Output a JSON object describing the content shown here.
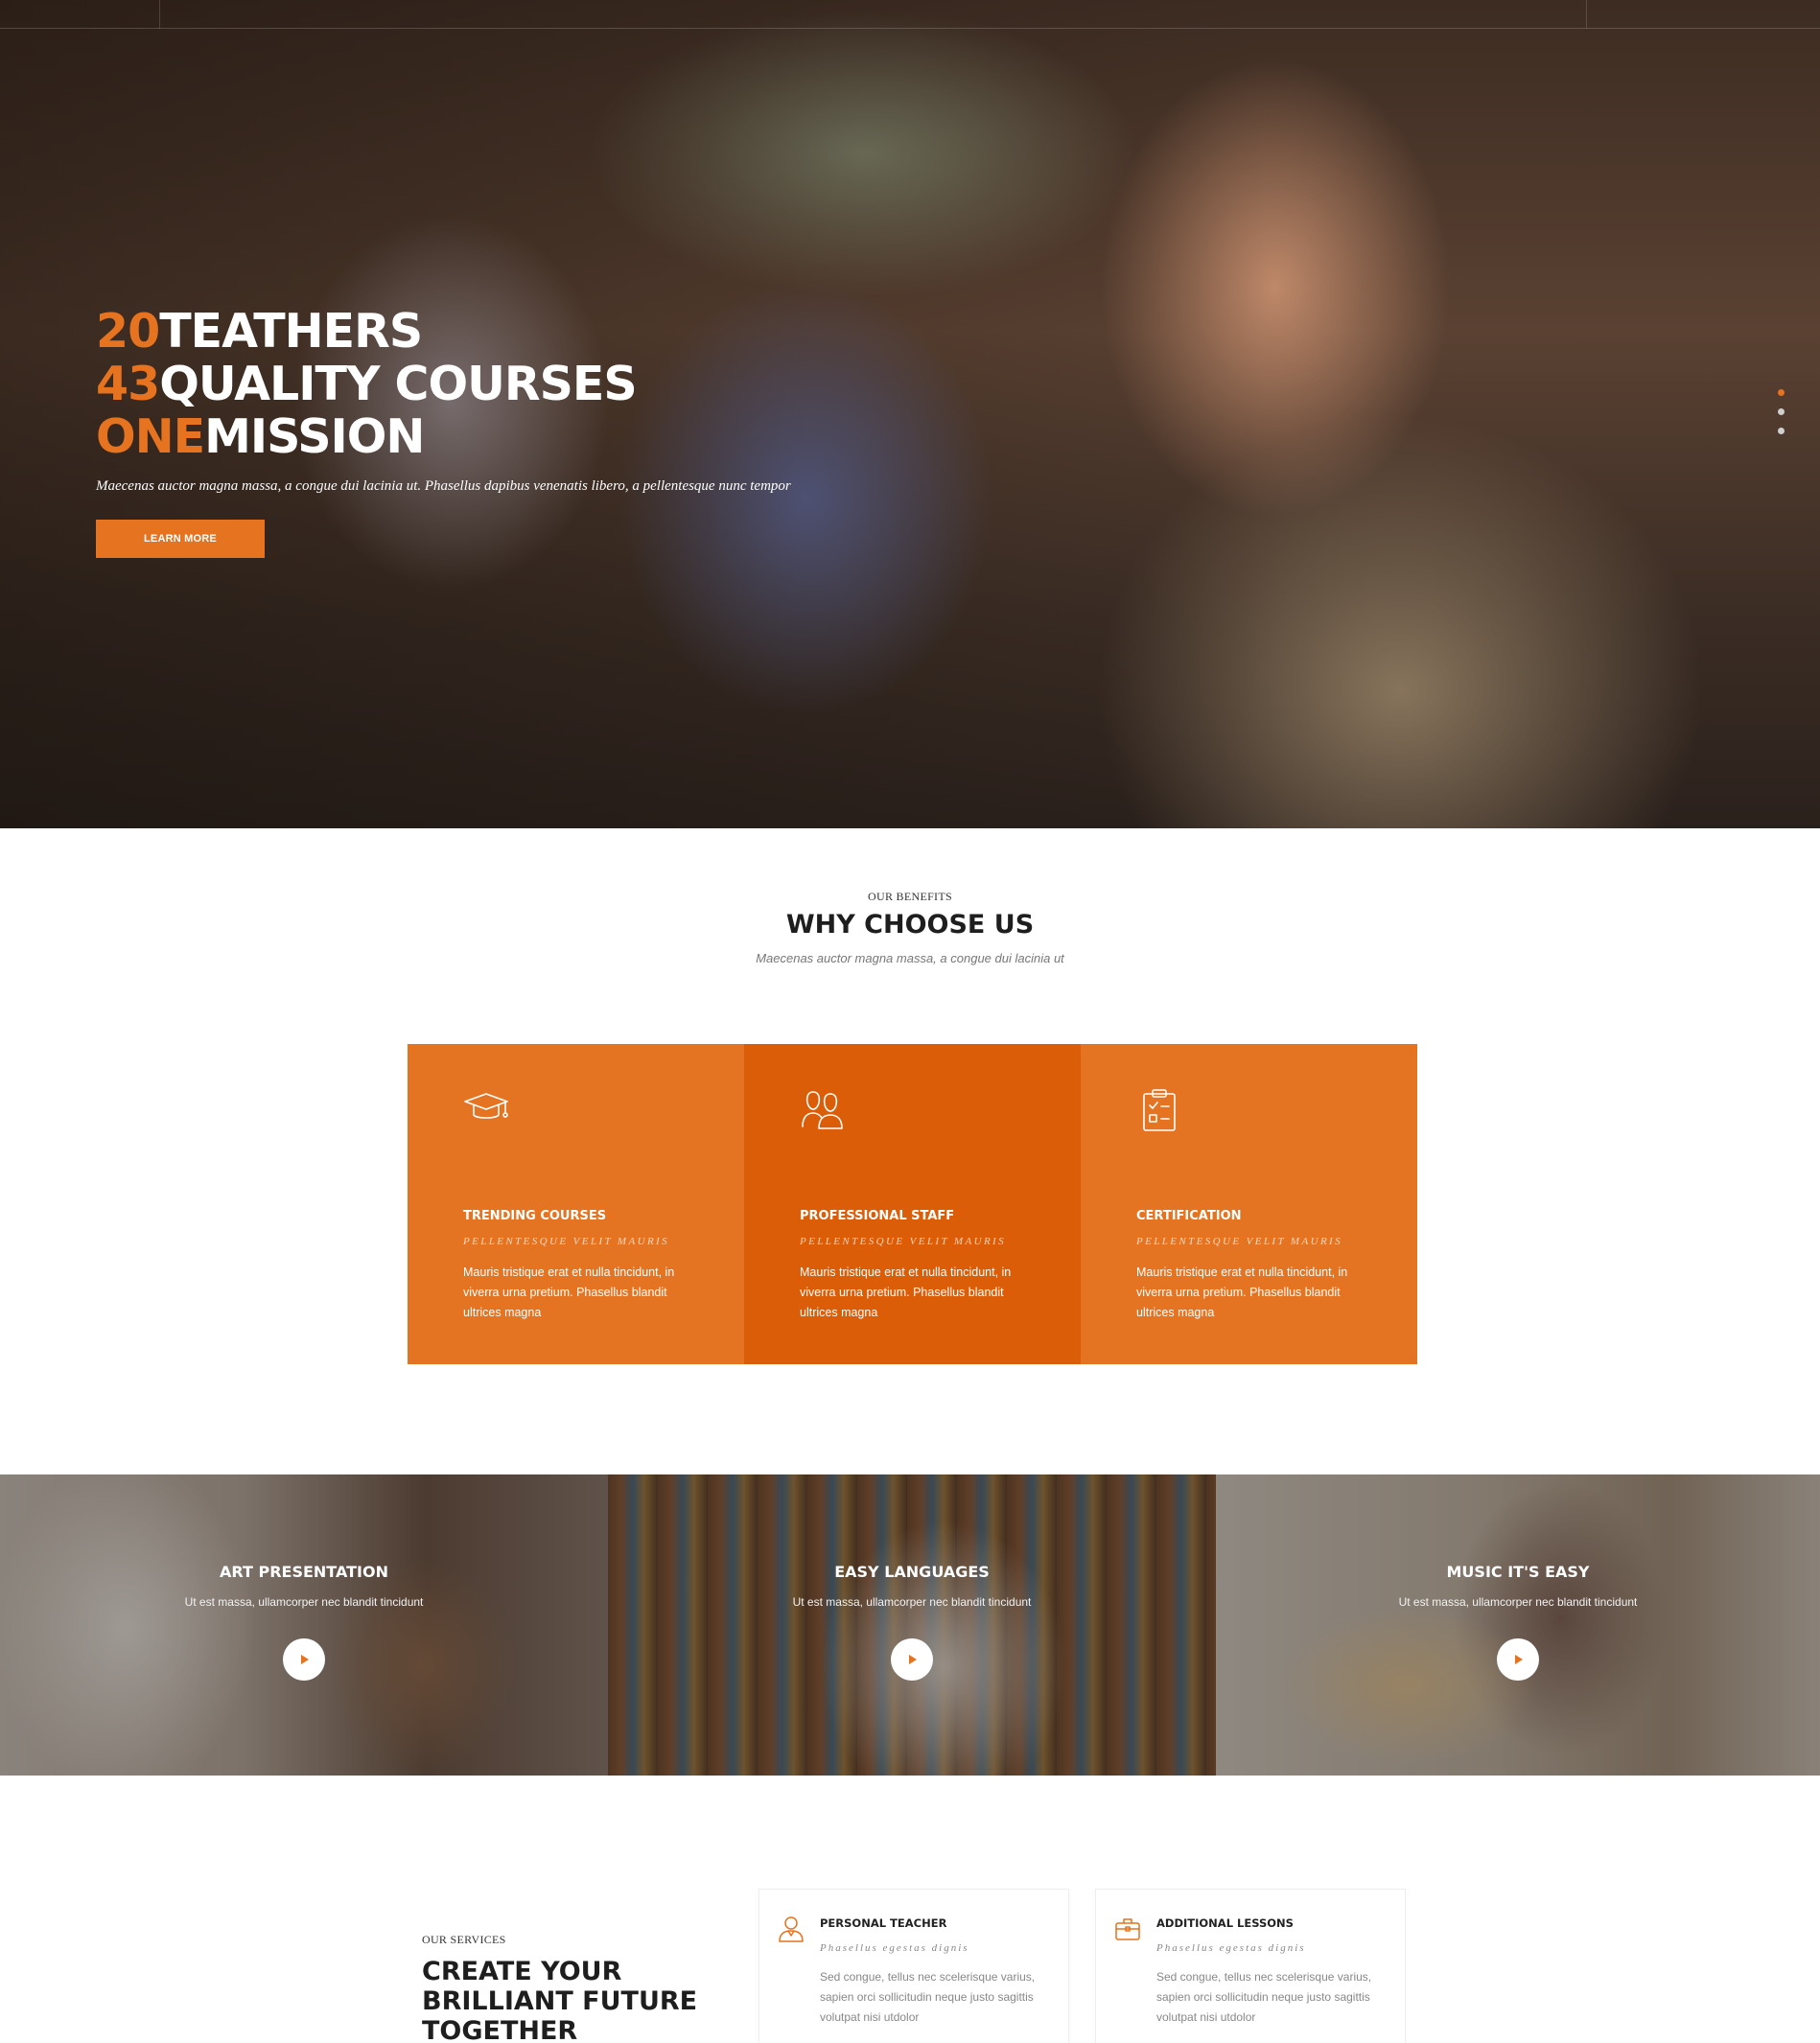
{
  "hero": {
    "lines": [
      {
        "accent": "20",
        "text": "TEATHERS"
      },
      {
        "accent": "43",
        "text": "QUALITY COURSES"
      },
      {
        "accent": "ONE",
        "text": "MISSION"
      }
    ],
    "subtitle": "Maecenas auctor magna massa, a congue dui lacinia ut. Phasellus dapibus venenatis libero, a pellentesque nunc tempor",
    "button_label": "LEARN MORE",
    "slide_count": 3,
    "active_slide": 1
  },
  "benefits": {
    "eyebrow": "OUR BENEFITS",
    "title": "WHY CHOOSE US",
    "subtitle": "Maecenas auctor magna massa, a congue dui lacinia ut",
    "cards": [
      {
        "icon": "graduation-cap-icon",
        "title": "TRENDING COURSES",
        "tag": "PELLENTESQUE VELIT MAURIS",
        "text": "Mauris tristique erat et nulla tincidunt, in viverra urna pretium. Phasellus blandit ultrices magna"
      },
      {
        "icon": "staff-group-icon",
        "title": "PROFESSIONAL STAFF",
        "tag": "PELLENTESQUE VELIT MAURIS",
        "text": "Mauris tristique erat et nulla tincidunt, in viverra urna pretium. Phasellus blandit ultrices magna"
      },
      {
        "icon": "clipboard-check-icon",
        "title": "CERTIFICATION",
        "tag": "PELLENTESQUE VELIT MAURIS",
        "text": "Mauris tristique erat et nulla tincidunt, in viverra urna pretium. Phasellus blandit ultrices magna"
      }
    ]
  },
  "gallery": [
    {
      "title": "ART PRESENTATION",
      "subtitle": "Ut est massa, ullamcorper nec blandit tincidunt"
    },
    {
      "title": "EASY LANGUAGES",
      "subtitle": "Ut est massa, ullamcorper nec blandit tincidunt"
    },
    {
      "title": "MUSIC IT'S EASY",
      "subtitle": "Ut est massa, ullamcorper nec blandit tincidunt"
    }
  ],
  "services": {
    "eyebrow": "OUR SERVICES",
    "title": "CREATE YOUR BRILLIANT FUTURE TOGETHER",
    "cards": [
      {
        "icon": "teacher-person-icon",
        "title": "PERSONAL TEACHER",
        "tag": "Phasellus egestas dignis",
        "text": "Sed congue, tellus nec scelerisque varius, sapien orci sollicitudin neque justo sagittis volutpat nisi utdolor"
      },
      {
        "icon": "briefcase-icon",
        "title": "ADDITIONAL LESSONS",
        "tag": "Phasellus egestas dignis",
        "text": "Sed congue, tellus nec scelerisque varius, sapien orci sollicitudin neque justo sagittis volutpat nisi utdolor"
      }
    ]
  },
  "colors": {
    "accent": "#e5731f",
    "accent_dark": "#dc5d08",
    "card_orange": "#e47422"
  }
}
